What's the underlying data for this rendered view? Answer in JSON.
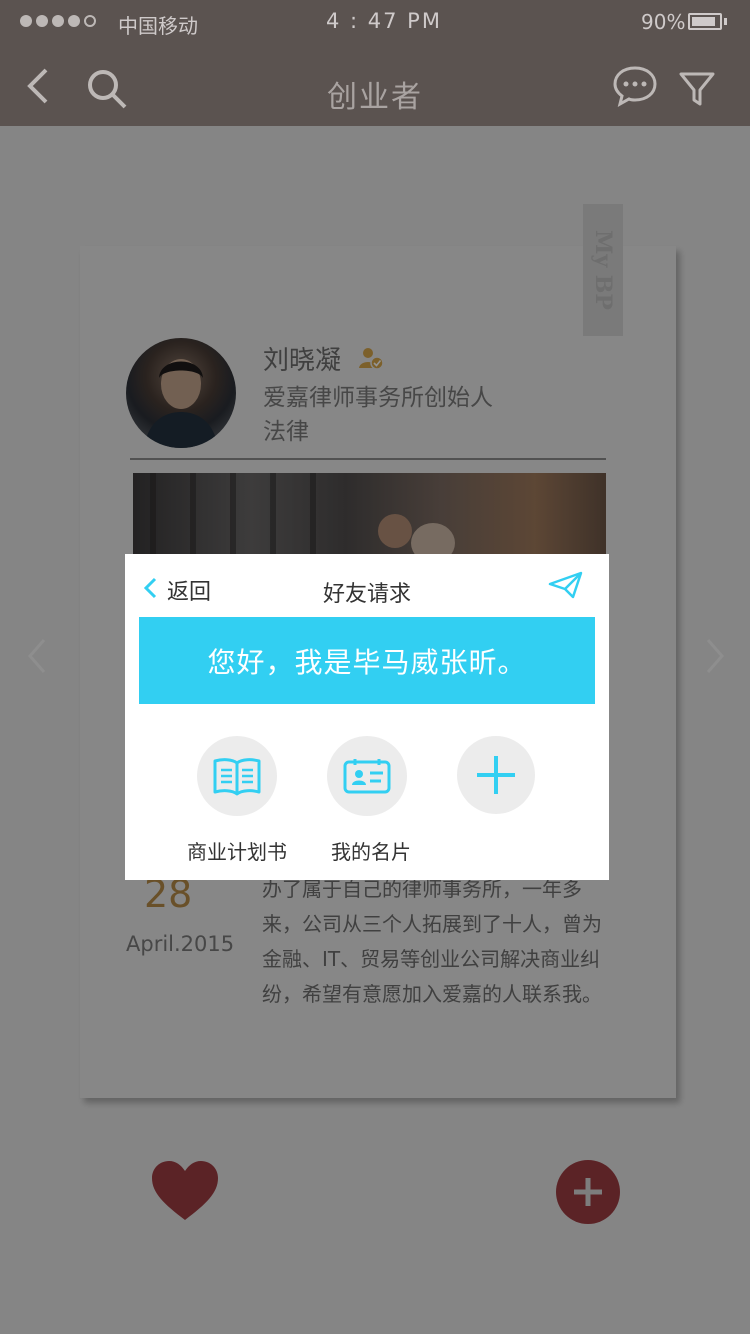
{
  "status_bar": {
    "carrier": "中国移动",
    "time": "4 : 47 PM",
    "battery": "90%",
    "battery_level": 0.9,
    "signal_bars": 4
  },
  "nav": {
    "title": "创业者",
    "back_icon": "chevron-left-icon",
    "search_icon": "search-icon",
    "message_icon": "chat-bubble-icon",
    "filter_icon": "filter-icon"
  },
  "card": {
    "tab_label": "My BP",
    "name": "刘晓凝",
    "company": "爱嘉律师事务所创始人",
    "industry": "法律",
    "date_day": "28",
    "date_month": "April.2015",
    "description_lines": [
      "办了属于自己的律师事务所，一年多",
      "来，公司从三个人拓展到了十人，曾为",
      "金融、IT、贸易等创业公司解决商业纠",
      "纷，希望有意愿加入爱嘉的人联系我。"
    ]
  },
  "modal": {
    "back_label": "返回",
    "title": "好友请求",
    "message": "您好，我是毕马威张昕。",
    "options": [
      {
        "label": "商业计划书",
        "icon": "book-icon"
      },
      {
        "label": "我的名片",
        "icon": "id-card-icon"
      },
      {
        "label": "",
        "icon": "plus-icon"
      }
    ]
  },
  "colors": {
    "accent": "#32cff2",
    "nav_bg": "#5b5350",
    "like": "#9e3d43",
    "date": "#b58a48"
  }
}
